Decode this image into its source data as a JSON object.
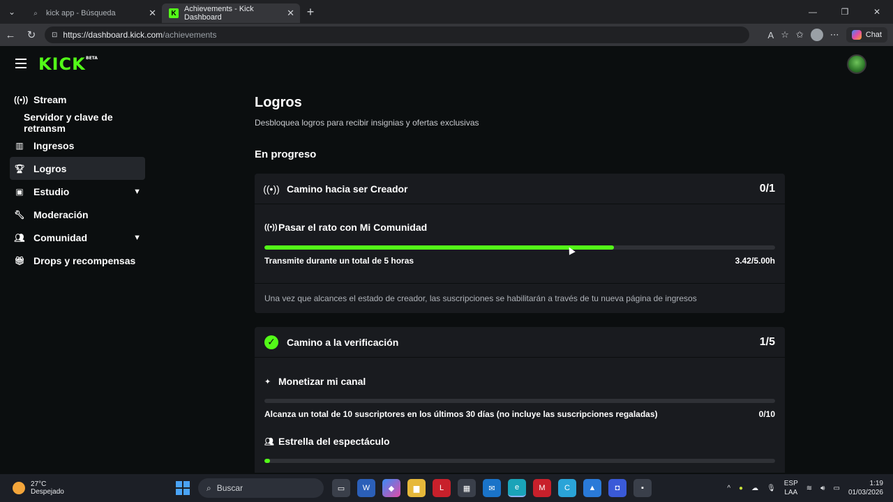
{
  "browser": {
    "tabs": [
      {
        "label": "kick app - Búsqueda",
        "icon": "search-icon"
      },
      {
        "label": "Achievements - Kick Dashboard",
        "icon": "kick-favicon"
      }
    ],
    "url_host": "https://dashboard.kick.com",
    "url_path": "/achievements",
    "chat_label": "Chat"
  },
  "app": {
    "logo": "KICK",
    "logo_badge": "BETA"
  },
  "sidebar": {
    "items": [
      {
        "label": "Stream",
        "icon": "broadcast-icon"
      },
      {
        "label": "Servidor y clave de retransm"
      },
      {
        "label": "Ingresos",
        "icon": "chart-icon"
      },
      {
        "label": "Logros",
        "icon": "trophy-icon"
      },
      {
        "label": "Estudio",
        "icon": "studio-icon"
      },
      {
        "label": "Moderación",
        "icon": "wrench-icon"
      },
      {
        "label": "Comunidad",
        "icon": "community-icon"
      },
      {
        "label": "Drops y recompensas",
        "icon": "gift-icon"
      }
    ]
  },
  "main": {
    "title": "Logros",
    "subtitle": "Desbloquea logros para recibir insignias y ofertas exclusivas",
    "section": "En progreso",
    "cards": [
      {
        "title": "Camino hacia ser Creador",
        "count": "0/1",
        "task_title": "Pasar el rato con Mi Comunidad",
        "progress": 0.684,
        "task_desc": "Transmite durante un total de 5 horas",
        "task_value": "3.42/5.00h",
        "note": "Una vez que alcances el estado de creador, las suscripciones se habilitarán a través de tu nueva página de ingresos"
      },
      {
        "title": "Camino a la verificación",
        "count": "1/5",
        "task_title": "Monetizar mi canal",
        "progress": 0,
        "task_desc": "Alcanza un total de 10 suscriptores en los últimos 30 días (no incluye las suscripciones regaladas)",
        "task_value": "0/10",
        "task2_title": "Estrella del espectáculo",
        "task2_progress": 0.007
      }
    ]
  },
  "taskbar": {
    "temp": "27°C",
    "weather": "Despejado",
    "search": "Buscar",
    "lang1": "ESP",
    "lang2": "LAA",
    "time": "1:19",
    "date": "01/03/2026"
  },
  "colors": {
    "accent": "#53fc18",
    "bg": "#0b0e0f",
    "card": "#191b1f"
  }
}
